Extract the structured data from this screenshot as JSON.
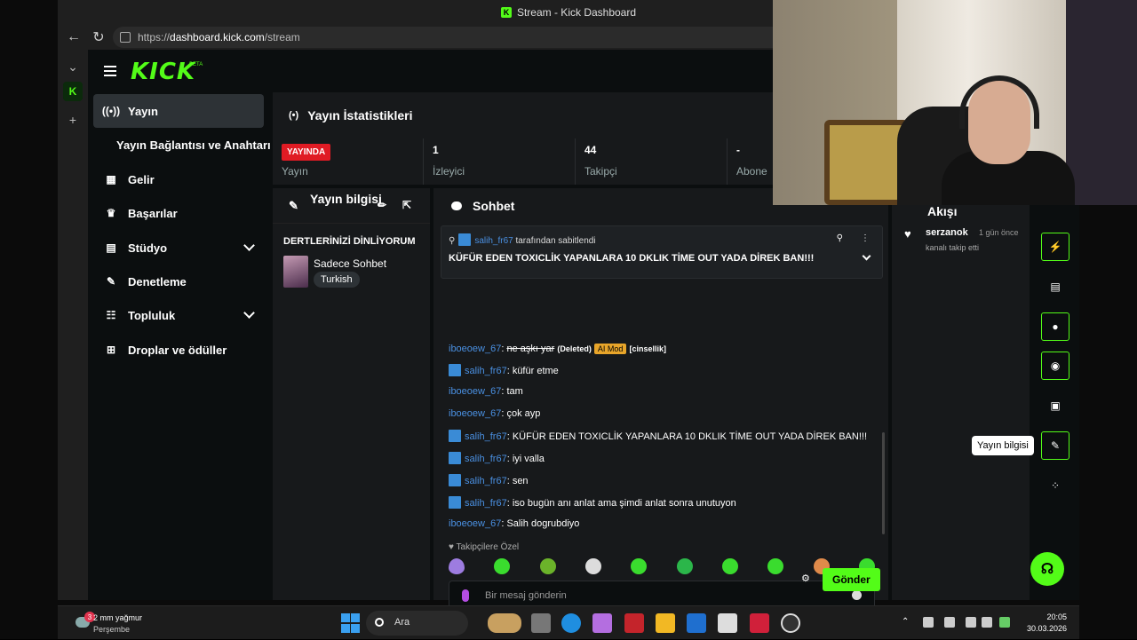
{
  "browser": {
    "window_title": "Stream - Kick Dashboard",
    "url_scheme": "https://",
    "url_host": "dashboard.kick.com",
    "url_path": "/stream"
  },
  "brand": {
    "logo": "KICK",
    "beta": "BETA",
    "accent": "#53fc18"
  },
  "nav": {
    "items": [
      {
        "label": "Yayın",
        "icon": "broadcast-icon"
      },
      {
        "label": "Yayın Bağlantısı ve Anahtarı"
      },
      {
        "label": "Gelir",
        "icon": "revenue-icon"
      },
      {
        "label": "Başarılar",
        "icon": "trophy-icon"
      },
      {
        "label": "Stüdyo",
        "icon": "studio-icon"
      },
      {
        "label": "Denetleme",
        "icon": "wrench-icon"
      },
      {
        "label": "Topluluk",
        "icon": "community-icon"
      },
      {
        "label": "Droplar ve ödüller",
        "icon": "gift-icon"
      }
    ]
  },
  "stats": {
    "title": "Yayın İstatistikleri",
    "live_badge": "YAYINDA",
    "cells": [
      {
        "label": "Yayın"
      },
      {
        "value": "1",
        "label": "İzleyici"
      },
      {
        "value": "44",
        "label": "Takipçi"
      },
      {
        "value": "-",
        "label": "Abone"
      }
    ]
  },
  "stream_info": {
    "title": "Yayın bilgisi",
    "stream_title": "DERTLERİNİZİ DİNLİYORUM",
    "category": "Sadece Sohbet",
    "language": "Turkish"
  },
  "chat": {
    "title": "Sohbet",
    "pinned_by_user": "salih_fr67",
    "pinned_by_text": "tarafından sabitlendi",
    "pinned_message": "KÜFÜR EDEN TOXICLİK YAPANLARA 10 DKLIK TİME OUT YADA DİREK BAN!!!",
    "messages": [
      {
        "user": "iboeoew_67",
        "text": "ne aşkı yar",
        "deleted": "(Deleted)",
        "ai": "AI Mod",
        "reason": "[cinsellik]"
      },
      {
        "user": "salih_fr67",
        "text": ": küfür etme",
        "mod": true
      },
      {
        "user": "iboeoew_67",
        "text": ": tam"
      },
      {
        "user": "iboeoew_67",
        "text": ": çok ayp"
      },
      {
        "user": "salih_fr67",
        "text": ": KÜFÜR EDEN TOXICLİK YAPANLARA 10 DKLIK TİME OUT YADA DİREK BAN!!!",
        "mod": true
      },
      {
        "user": "salih_fr67",
        "text": ": iyi valla",
        "mod": true
      },
      {
        "user": "salih_fr67",
        "text": ": sen",
        "mod": true
      },
      {
        "user": "salih_fr67",
        "text": ": iso bugün anı anlat ama şimdi anlat sonra unutuyon",
        "mod": true
      },
      {
        "user": "iboeoew_67",
        "text": ": Salih dogrubdiyo"
      }
    ],
    "followers_only": "Takipçilere Özel",
    "input_placeholder": "Bir mesaj gönderin",
    "send_label": "Gönder"
  },
  "feed": {
    "title": "Akışı",
    "event_user": "serzanok",
    "event_time": "1 gün önce",
    "event_text": "kanalı takip etti"
  },
  "tooltip": "Yayın bilgisi",
  "taskbar": {
    "weather_line1": "2 mm yağmur",
    "weather_line2": "Perşembe",
    "weather_badge": "3",
    "search_label": "Ara",
    "time": "20:05",
    "date": "30.03.2026"
  }
}
